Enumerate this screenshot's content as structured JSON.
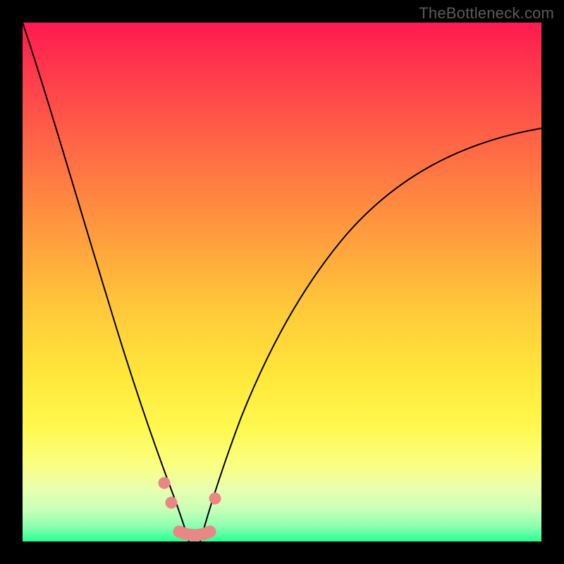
{
  "watermark": "TheBottleneck.com",
  "colors": {
    "background_frame": "#000000",
    "gradient_top": "#ff1a4f",
    "gradient_bottom": "#25ff92",
    "curve": "#000000",
    "marker": "#e98787"
  },
  "chart_data": {
    "type": "line",
    "title": "",
    "xlabel": "",
    "ylabel": "",
    "xlim": [
      0,
      100
    ],
    "ylim": [
      0,
      100
    ],
    "annotations": [
      "TheBottleneck.com"
    ],
    "series": [
      {
        "name": "left-curve",
        "x": [
          0,
          2,
          5,
          8,
          11,
          14,
          17,
          20,
          23,
          26,
          28,
          30,
          31.5
        ],
        "values": [
          100,
          90,
          76,
          64,
          53,
          43,
          34,
          26,
          19,
          12,
          8,
          4,
          0
        ]
      },
      {
        "name": "right-curve",
        "x": [
          34,
          36,
          39,
          43,
          48,
          54,
          61,
          69,
          78,
          88,
          100
        ],
        "values": [
          0,
          5,
          12,
          22,
          33,
          44,
          54,
          62,
          69,
          75,
          80
        ]
      }
    ],
    "markers": [
      {
        "name": "left-bead-upper",
        "x": 27,
        "y": 11
      },
      {
        "name": "left-bead-lower",
        "x": 28.5,
        "y": 7
      },
      {
        "name": "right-bead-upper",
        "x": 37,
        "y": 8
      },
      {
        "name": "valley-segment-start",
        "x": 30,
        "y": 1.5
      },
      {
        "name": "valley-segment-end",
        "x": 36,
        "y": 1.5
      }
    ],
    "legend": null,
    "grid": false
  }
}
